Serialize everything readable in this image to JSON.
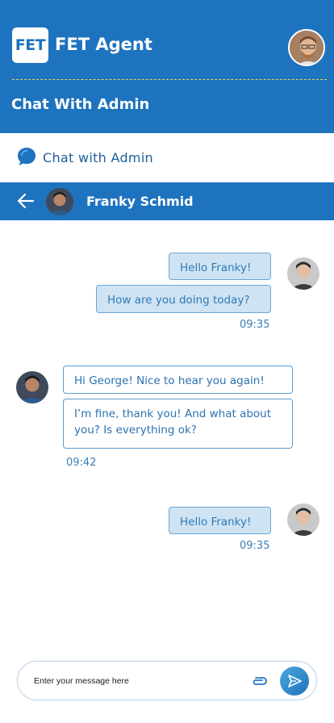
{
  "app": {
    "logo_text": "FET",
    "title": "FET Agent",
    "page_title": "Chat With Admin"
  },
  "section": {
    "label": "Chat with Admin"
  },
  "chat": {
    "contact_name": "Franky Schmid",
    "messages": [
      {
        "text": "Hello Franky!"
      },
      {
        "text": "How are you doing today?"
      },
      {
        "time": "09:35"
      },
      {
        "text": "Hi George! Nice to hear you again!"
      },
      {
        "text": "I’m fine, thank you! And what about you? Is everything ok?"
      },
      {
        "time": "09:42"
      },
      {
        "text": "Hello Franky!"
      },
      {
        "time": "09:35"
      }
    ]
  },
  "composer": {
    "placeholder": "Enter your message here"
  },
  "icons": {
    "section": "chat-bubble-icon",
    "back": "arrow-left-icon",
    "attach": "paperclip-icon",
    "send": "send-icon"
  },
  "colors": {
    "primary": "#1e73be",
    "sent_bubble": "#cfe3f3",
    "accent_line": "#e6d84f"
  }
}
